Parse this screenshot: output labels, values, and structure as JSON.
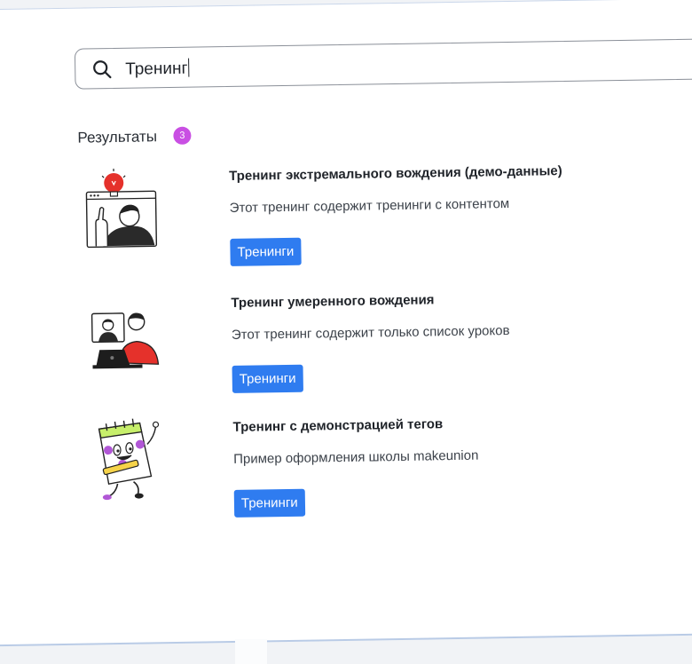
{
  "search": {
    "value": "Тренинг"
  },
  "results": {
    "label": "Результаты",
    "count": "3",
    "items": [
      {
        "title": "Тренинг экстремального вождения (демо-данные)",
        "description": "Этот тренинг содержит тренинги с контентом",
        "tag": "Тренинги"
      },
      {
        "title": "Тренинг умеренного вождения",
        "description": "Этот тренинг содержит только список уроков",
        "tag": "Тренинги"
      },
      {
        "title": "Тренинг с демонстрацией тегов",
        "description": "Пример оформления школы makeunion",
        "tag": "Тренинги"
      }
    ]
  },
  "colors": {
    "accent": "#2f7cf0",
    "badge": "#c94fe3",
    "illustration_red": "#e5312b",
    "illustration_purple": "#b157d6"
  }
}
